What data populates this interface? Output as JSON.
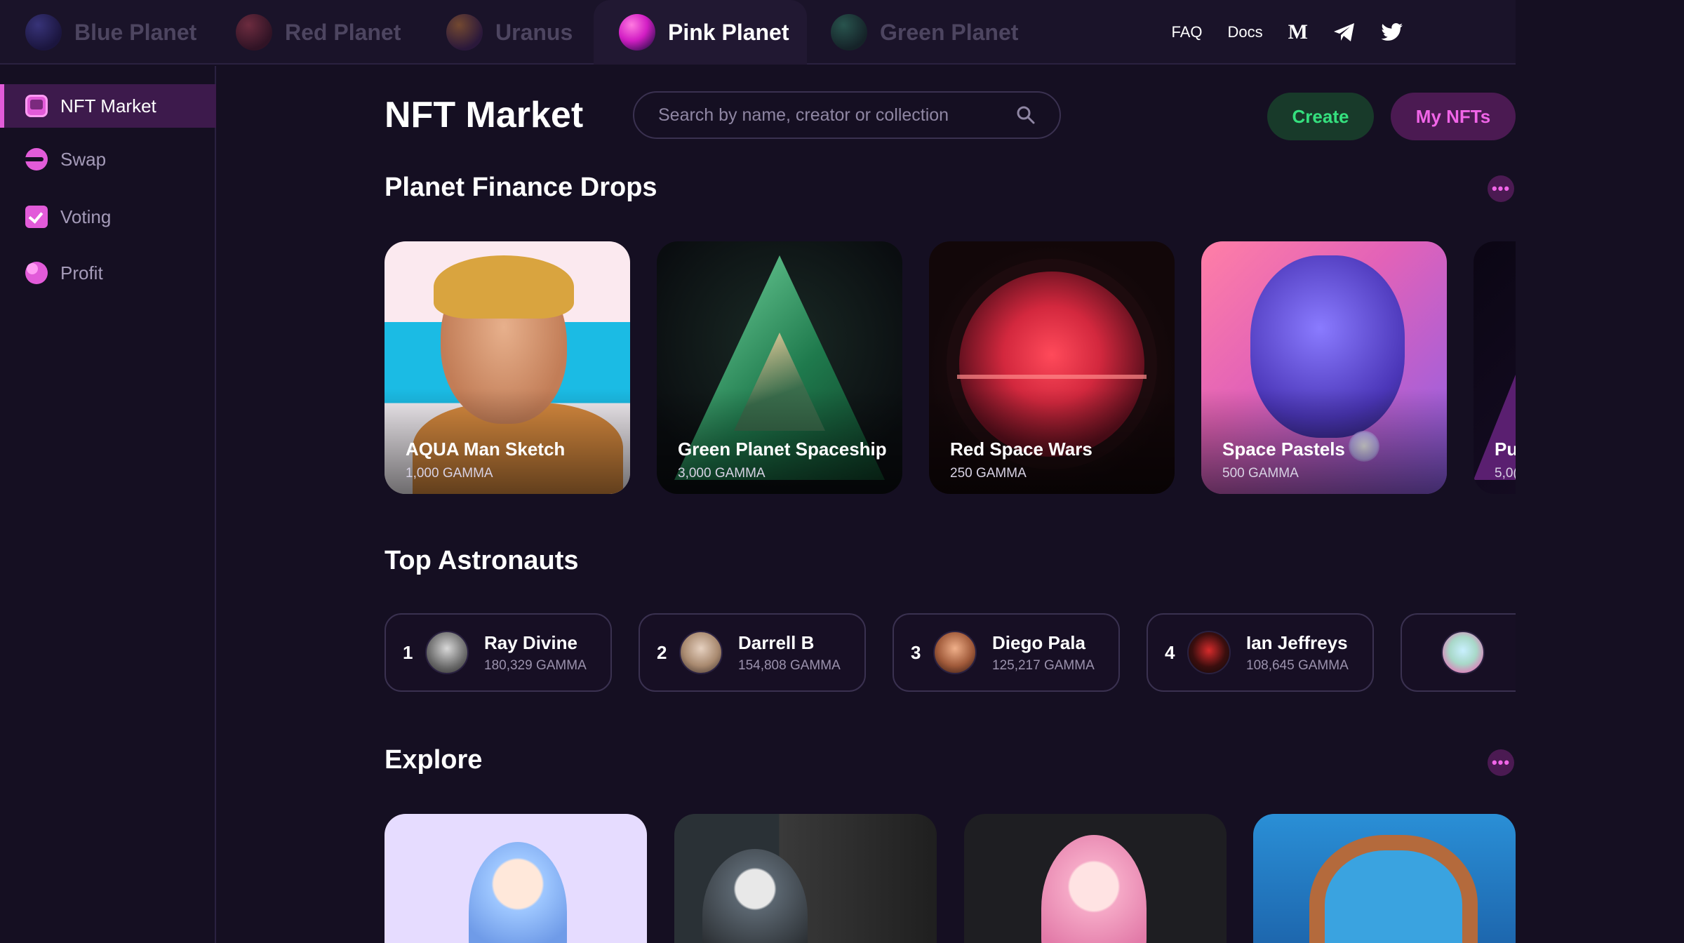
{
  "planet_tabs": [
    {
      "label": "Blue Planet",
      "active": false
    },
    {
      "label": "Red Planet",
      "active": false
    },
    {
      "label": "Uranus",
      "active": false
    },
    {
      "label": "Pink Planet",
      "active": true
    },
    {
      "label": "Green Planet",
      "active": false
    }
  ],
  "top_links": {
    "faq": "FAQ",
    "docs": "Docs",
    "medium_glyph": "M"
  },
  "sidebar": {
    "items": [
      {
        "label": "NFT Market",
        "icon": "market-icon",
        "active": true
      },
      {
        "label": "Swap",
        "icon": "swap-icon",
        "active": false
      },
      {
        "label": "Voting",
        "icon": "voting-icon",
        "active": false
      },
      {
        "label": "Profit",
        "icon": "profit-icon",
        "active": false
      }
    ]
  },
  "header": {
    "title": "NFT Market",
    "search_placeholder": "Search by name, creator or collection",
    "create_label": "Create",
    "my_nfts_label": "My NFTs"
  },
  "drops": {
    "title": "Planet Finance Drops",
    "items": [
      {
        "name": "AQUA Man Sketch",
        "price": "1,000 GAMMA"
      },
      {
        "name": "Green Planet Spaceship",
        "price": "3,000 GAMMA"
      },
      {
        "name": "Red Space Wars",
        "price": "250 GAMMA"
      },
      {
        "name": "Space Pastels",
        "price": "500 GAMMA"
      },
      {
        "name": "Pu",
        "price": "5,0("
      }
    ]
  },
  "astronauts": {
    "title": "Top Astronauts",
    "items": [
      {
        "rank": "1",
        "name": "Ray Divine",
        "score": "180,329 GAMMA"
      },
      {
        "rank": "2",
        "name": "Darrell B",
        "score": "154,808 GAMMA"
      },
      {
        "rank": "3",
        "name": "Diego Pala",
        "score": "125,217 GAMMA"
      },
      {
        "rank": "4",
        "name": "Ian Jeffreys",
        "score": "108,645 GAMMA"
      }
    ]
  },
  "explore": {
    "title": "Explore"
  },
  "more_glyph": "•••",
  "colors": {
    "background": "#150f22",
    "accent_pink": "#e25bd9",
    "create_green": "#35e07e",
    "my_nfts_pink": "#f165e8"
  }
}
